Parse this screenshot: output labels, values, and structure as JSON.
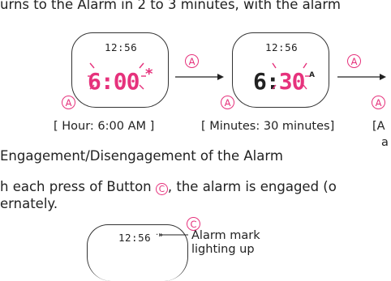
{
  "doc": {
    "line_top": "urns to the Alarm in 2 to 3 minutes, with the alarm",
    "heading": "Engagement/Disengagement of the Alarm",
    "body_line1_pre": "h each press of Button ",
    "body_line1_post": ", the alarm is engaged (o",
    "body_line2": "ernately."
  },
  "watches": [
    {
      "time": "12:56",
      "display_lit": "6:00",
      "display_dim": "",
      "mark": "*"
    },
    {
      "time": "12:56",
      "display_lit": "6:",
      "display_dim": "30",
      "mark": "A"
    },
    {
      "time": "12:56",
      "alarm_mark": "·»"
    }
  ],
  "buttons": {
    "a": "A",
    "c": "C"
  },
  "captions": {
    "hour": "[ Hour: 6:00 AM ]",
    "minutes": "[ Minutes: 30 minutes]",
    "cut_open": "[A",
    "cut_next": "a"
  },
  "callout": {
    "line1": "Alarm mark",
    "line2": "lighting up"
  },
  "colors": {
    "accent": "#e6327c",
    "text": "#222222"
  }
}
